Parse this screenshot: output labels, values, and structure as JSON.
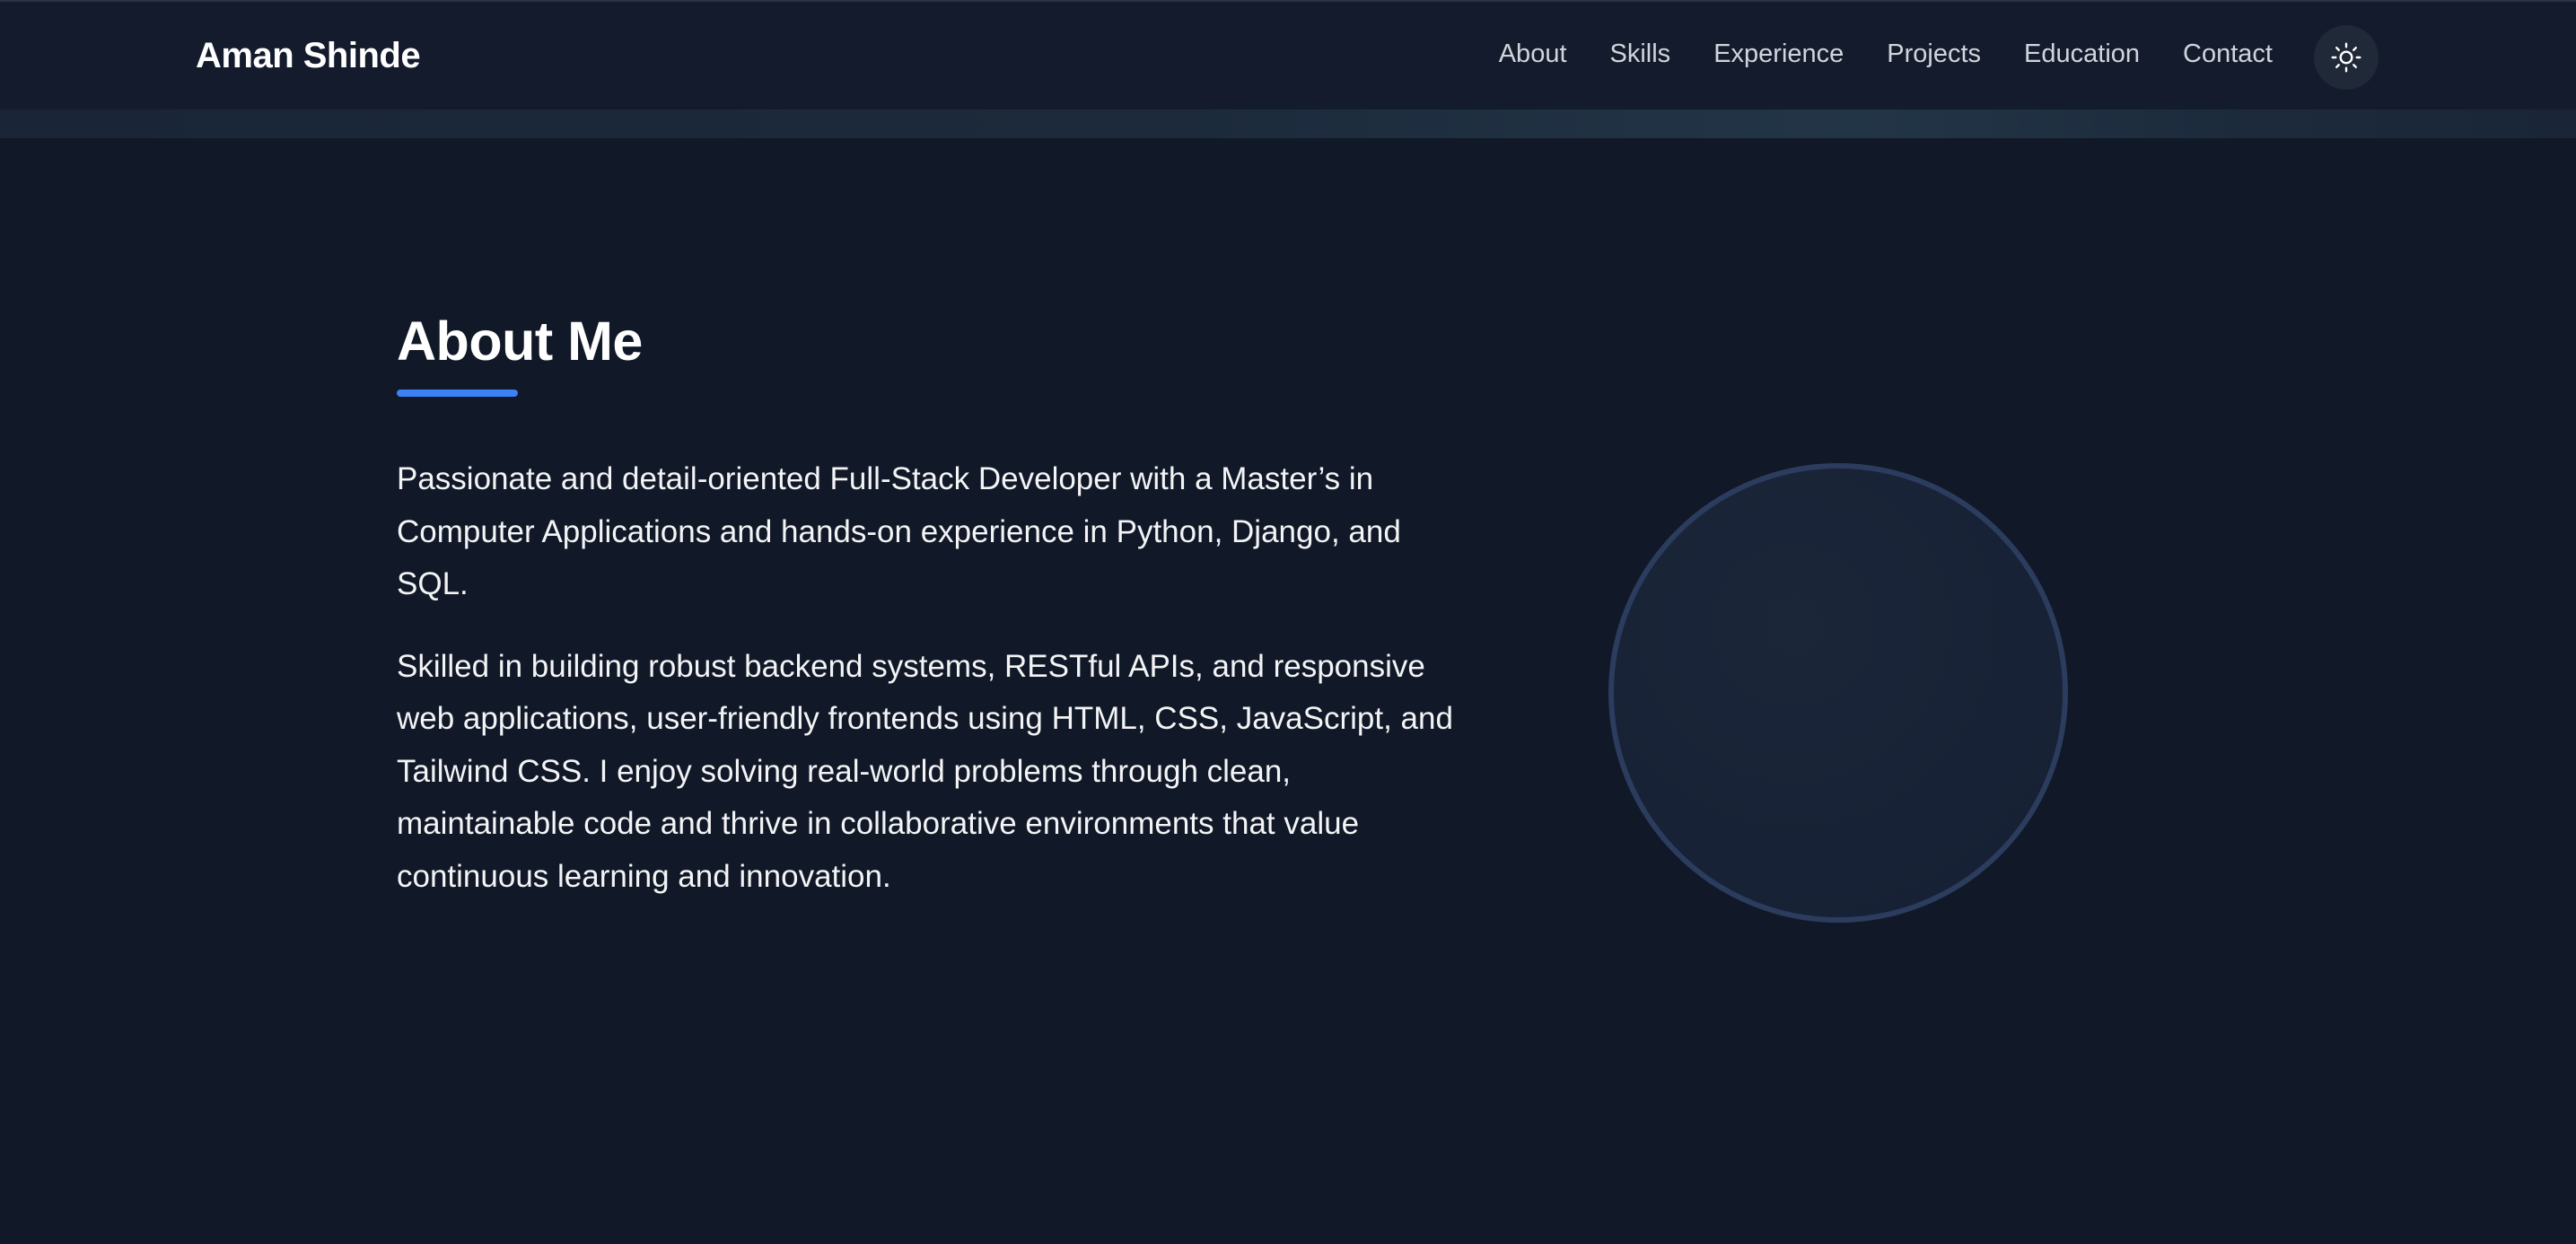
{
  "header": {
    "brand": "Aman Shinde",
    "nav": [
      "About",
      "Skills",
      "Experience",
      "Projects",
      "Education",
      "Contact"
    ],
    "theme_toggle_icon": "sun-icon"
  },
  "about": {
    "title": "About Me",
    "paragraphs": [
      "Passionate and detail-oriented Full-Stack Developer with a Master’s in Computer Applications and hands-on experience in Python, Django, and SQL.",
      "Skilled in building robust backend systems, RESTful APIs, and responsive web applications, user-friendly frontends using HTML, CSS, JavaScript, and Tailwind CSS. I enjoy solving real-world problems through clean, maintainable code and thrive in collaborative environments that value continuous learning and innovation."
    ]
  },
  "colors": {
    "background": "#111827",
    "navbar": "#141b2d",
    "accent": "#3b82f6",
    "circle_border": "#2b3c5e"
  }
}
